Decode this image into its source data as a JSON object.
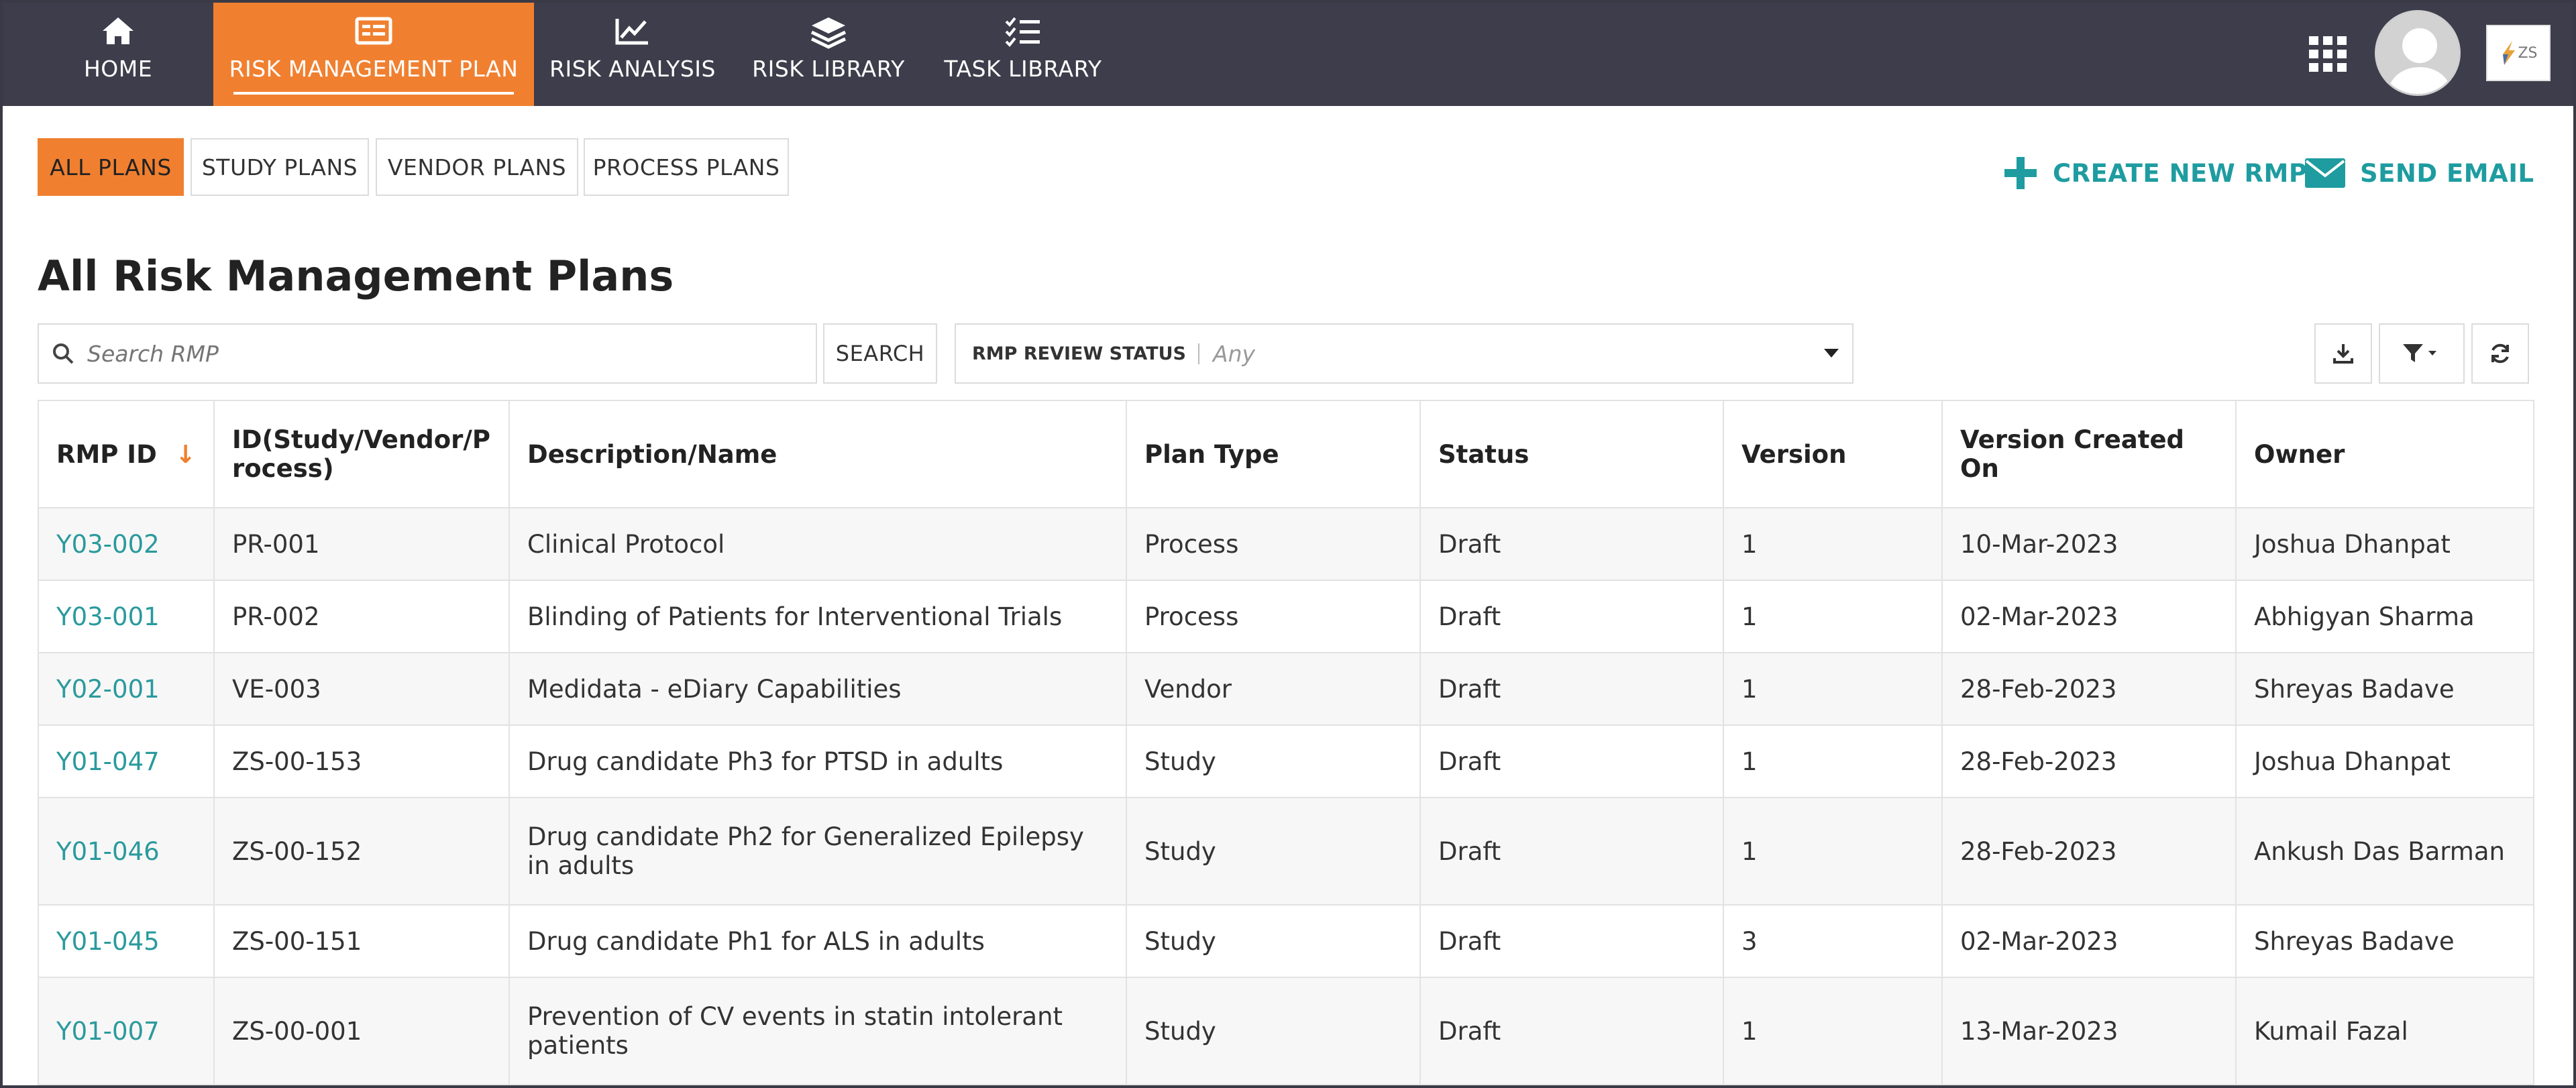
{
  "nav": {
    "items": [
      {
        "label": "HOME",
        "icon": "home-icon",
        "active": false
      },
      {
        "label": "RISK MANAGEMENT PLAN",
        "icon": "plan-icon",
        "active": true
      },
      {
        "label": "RISK ANALYSIS",
        "icon": "chart-icon",
        "active": false
      },
      {
        "label": "RISK LIBRARY",
        "icon": "layers-icon",
        "active": false
      },
      {
        "label": "TASK LIBRARY",
        "icon": "checklist-icon",
        "active": false
      }
    ],
    "logo_text": "ZS",
    "colors": {
      "bar": "#3d3d4b",
      "active": "#f08030"
    }
  },
  "subtabs": [
    {
      "label": "ALL PLANS",
      "active": true
    },
    {
      "label": "STUDY PLANS",
      "active": false
    },
    {
      "label": "VENDOR PLANS",
      "active": false
    },
    {
      "label": "PROCESS PLANS",
      "active": false
    }
  ],
  "actions": {
    "create_label": "CREATE NEW RMP",
    "email_label": "SEND EMAIL",
    "accent": "#1e9ca0"
  },
  "page_title": "All Risk Management Plans",
  "filters": {
    "search_placeholder": "Search RMP",
    "search_button": "SEARCH",
    "status_label": "RMP REVIEW STATUS",
    "status_value": "Any"
  },
  "table": {
    "columns": [
      "RMP ID",
      "ID(Study/Vendor/Process)",
      "Description/Name",
      "Plan Type",
      "Status",
      "Version",
      "Version Created On",
      "Owner"
    ],
    "sort_indicator": "↓",
    "rows": [
      {
        "rmp_id": "Y03-002",
        "id": "PR-001",
        "name": "Clinical Protocol",
        "type": "Process",
        "status": "Draft",
        "version": "1",
        "created": "10-Mar-2023",
        "owner": "Joshua Dhanpat"
      },
      {
        "rmp_id": "Y03-001",
        "id": "PR-002",
        "name": "Blinding of Patients for Interventional Trials",
        "type": "Process",
        "status": "Draft",
        "version": "1",
        "created": "02-Mar-2023",
        "owner": "Abhigyan Sharma"
      },
      {
        "rmp_id": "Y02-001",
        "id": "VE-003",
        "name": "Medidata - eDiary Capabilities",
        "type": "Vendor",
        "status": "Draft",
        "version": "1",
        "created": "28-Feb-2023",
        "owner": "Shreyas Badave"
      },
      {
        "rmp_id": "Y01-047",
        "id": "ZS-00-153",
        "name": "Drug candidate Ph3 for PTSD in adults",
        "type": "Study",
        "status": "Draft",
        "version": "1",
        "created": "28-Feb-2023",
        "owner": "Joshua Dhanpat"
      },
      {
        "rmp_id": "Y01-046",
        "id": "ZS-00-152",
        "name": "Drug candidate Ph2 for Generalized Epilepsy in adults",
        "type": "Study",
        "status": "Draft",
        "version": "1",
        "created": "28-Feb-2023",
        "owner": "Ankush Das Barman"
      },
      {
        "rmp_id": "Y01-045",
        "id": "ZS-00-151",
        "name": "Drug candidate Ph1 for ALS in adults",
        "type": "Study",
        "status": "Draft",
        "version": "3",
        "created": "02-Mar-2023",
        "owner": "Shreyas Badave"
      },
      {
        "rmp_id": "Y01-007",
        "id": "ZS-00-001",
        "name": "Prevention of CV events in statin intolerant patients",
        "type": "Study",
        "status": "Draft",
        "version": "1",
        "created": "13-Mar-2023",
        "owner": "Kumail Fazal"
      }
    ]
  }
}
